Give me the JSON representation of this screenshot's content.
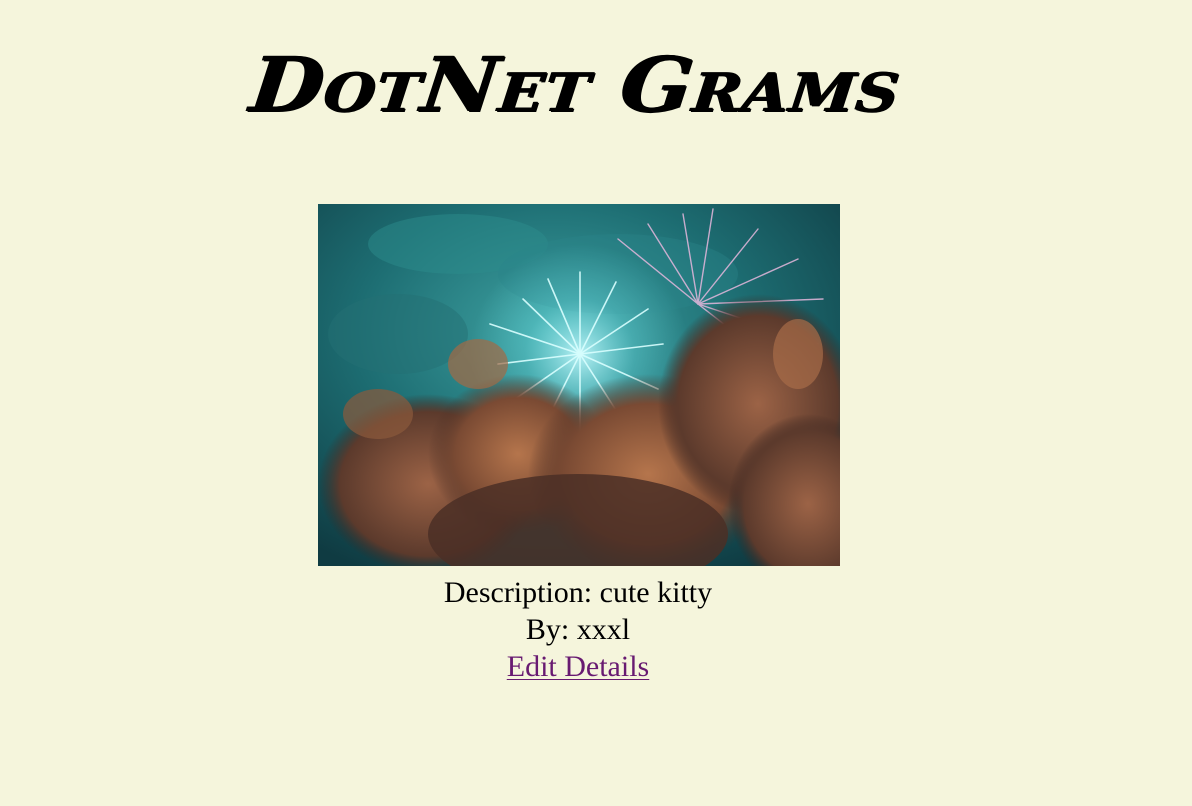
{
  "header": {
    "title": "DotNet Grams"
  },
  "post": {
    "image_subject": "fireworks over trees at night",
    "description_label": "Description:",
    "description_value": "cute kitty",
    "author_label": "By:",
    "author_value": "xxxl",
    "edit_link": "Edit Details"
  },
  "colors": {
    "page_background": "#f5f5dc",
    "link_visited": "#681a71",
    "text": "#000000"
  }
}
